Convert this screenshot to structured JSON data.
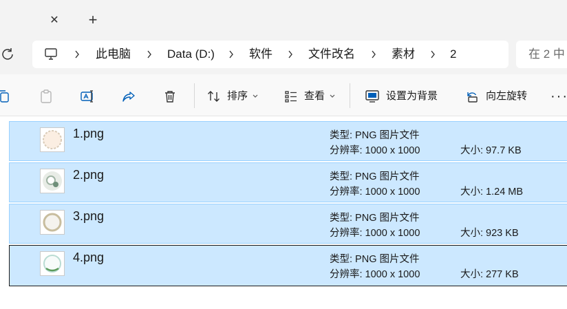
{
  "tabs": {
    "close_symbol": "✕",
    "new_symbol": "+"
  },
  "address": {
    "crumbs": [
      "此电脑",
      "Data (D:)",
      "软件",
      "文件改名",
      "素材",
      "2"
    ]
  },
  "search": {
    "placeholder": "在 2 中"
  },
  "commands": {
    "sort_label": "排序",
    "view_label": "查看",
    "set_background_label": "设置为背景",
    "rotate_left_label": "向左旋转",
    "more_label": "···"
  },
  "files": [
    {
      "name": "1.png",
      "type": "类型: PNG 图片文件",
      "resolution": "分辨率: 1000 x 1000",
      "size": "大小: 97.7 KB"
    },
    {
      "name": "2.png",
      "type": "类型: PNG 图片文件",
      "resolution": "分辨率: 1000 x 1000",
      "size": "大小: 1.24 MB"
    },
    {
      "name": "3.png",
      "type": "类型: PNG 图片文件",
      "resolution": "分辨率: 1000 x 1000",
      "size": "大小: 923 KB"
    },
    {
      "name": "4.png",
      "type": "类型: PNG 图片文件",
      "resolution": "分辨率: 1000 x 1000",
      "size": "大小: 277 KB"
    }
  ],
  "colors": {
    "selection": "#cce8ff",
    "selection_border": "#99d1ff",
    "chrome": "#f3f3f3",
    "accent": "#005fb8"
  }
}
